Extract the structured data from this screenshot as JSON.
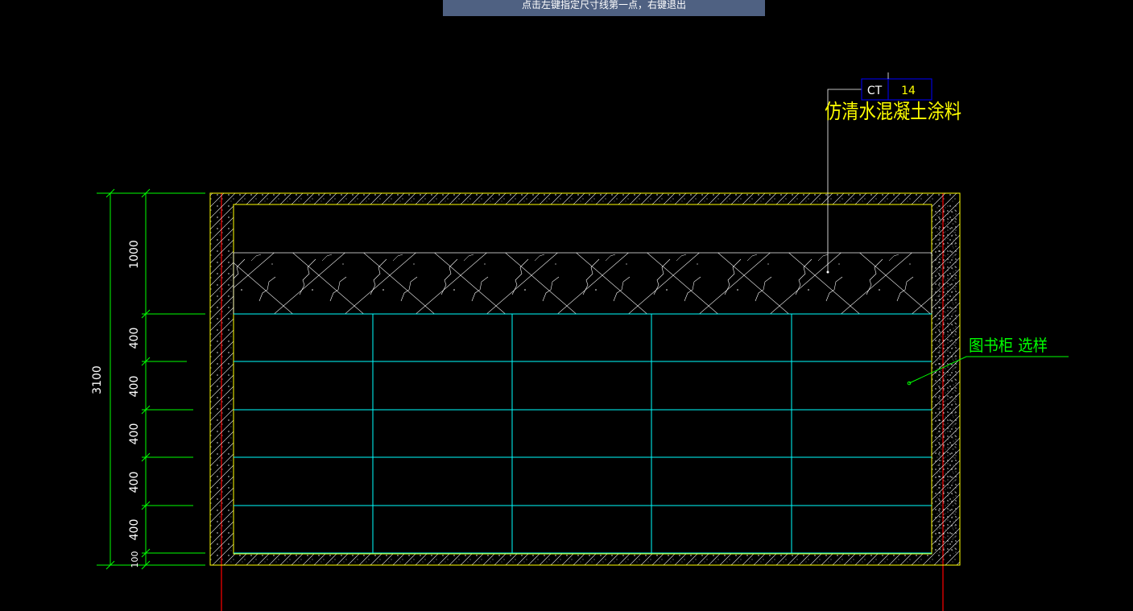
{
  "command_prompt": "点击左键指定尺寸线第一点，右键退出",
  "colors": {
    "background": "#000000",
    "frame": "#ffff00",
    "dimension": "#00ff00",
    "grid": "#00ffff",
    "axis": "#ff0000",
    "hatch": "#ffffff",
    "tag_box": "#0000ff",
    "leader_label": "#00ff00",
    "material_label": "#ffff00",
    "prompt_bg": "#4f6182"
  },
  "material_tag": {
    "code": "CT",
    "number": "14",
    "description": "仿清水混凝土涂料"
  },
  "cabinet_label": "图书柜 选样",
  "dimensions": {
    "total": "3100",
    "segments": [
      "1000",
      "400",
      "400",
      "400",
      "400",
      "400",
      "100"
    ]
  }
}
